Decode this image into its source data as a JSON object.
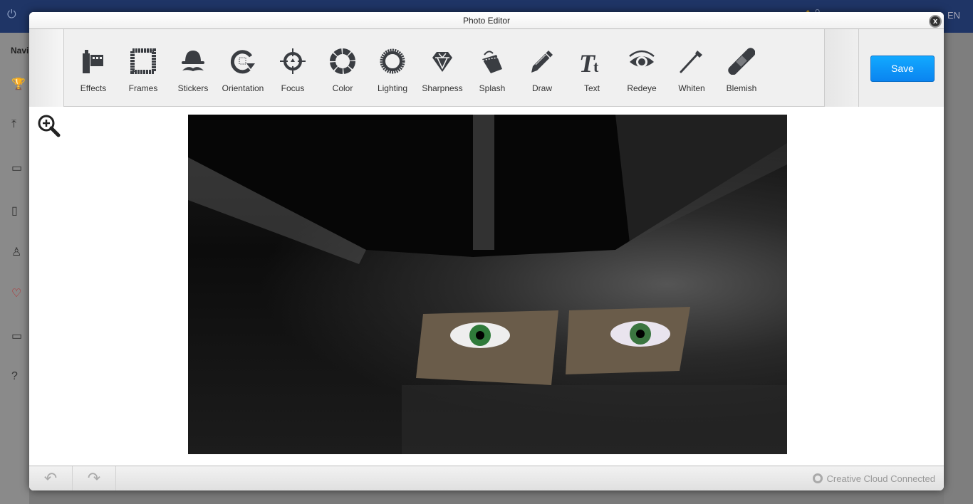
{
  "background": {
    "sidebar_label": "Navi",
    "language": "EN",
    "notification_count": "0"
  },
  "modal": {
    "title": "Photo Editor",
    "close_label": "x"
  },
  "tools": [
    {
      "label": "Effects",
      "icon": "film-icon"
    },
    {
      "label": "Frames",
      "icon": "frame-icon"
    },
    {
      "label": "Stickers",
      "icon": "bowler-mustache-icon"
    },
    {
      "label": "Orientation",
      "icon": "rotate-icon"
    },
    {
      "label": "Focus",
      "icon": "crosshair-icon"
    },
    {
      "label": "Color",
      "icon": "color-ring-icon"
    },
    {
      "label": "Lighting",
      "icon": "sun-icon"
    },
    {
      "label": "Sharpness",
      "icon": "diamond-icon"
    },
    {
      "label": "Splash",
      "icon": "paint-bucket-icon"
    },
    {
      "label": "Draw",
      "icon": "pencil-icon"
    },
    {
      "label": "Text",
      "icon": "text-icon"
    },
    {
      "label": "Redeye",
      "icon": "eye-icon"
    },
    {
      "label": "Whiten",
      "icon": "toothbrush-icon"
    },
    {
      "label": "Blemish",
      "icon": "bandage-icon"
    }
  ],
  "save_label": "Save",
  "footer": {
    "status": "Creative Cloud Connected"
  },
  "colors": {
    "accent": "#0a8ef5",
    "icon": "#3a3d42"
  }
}
